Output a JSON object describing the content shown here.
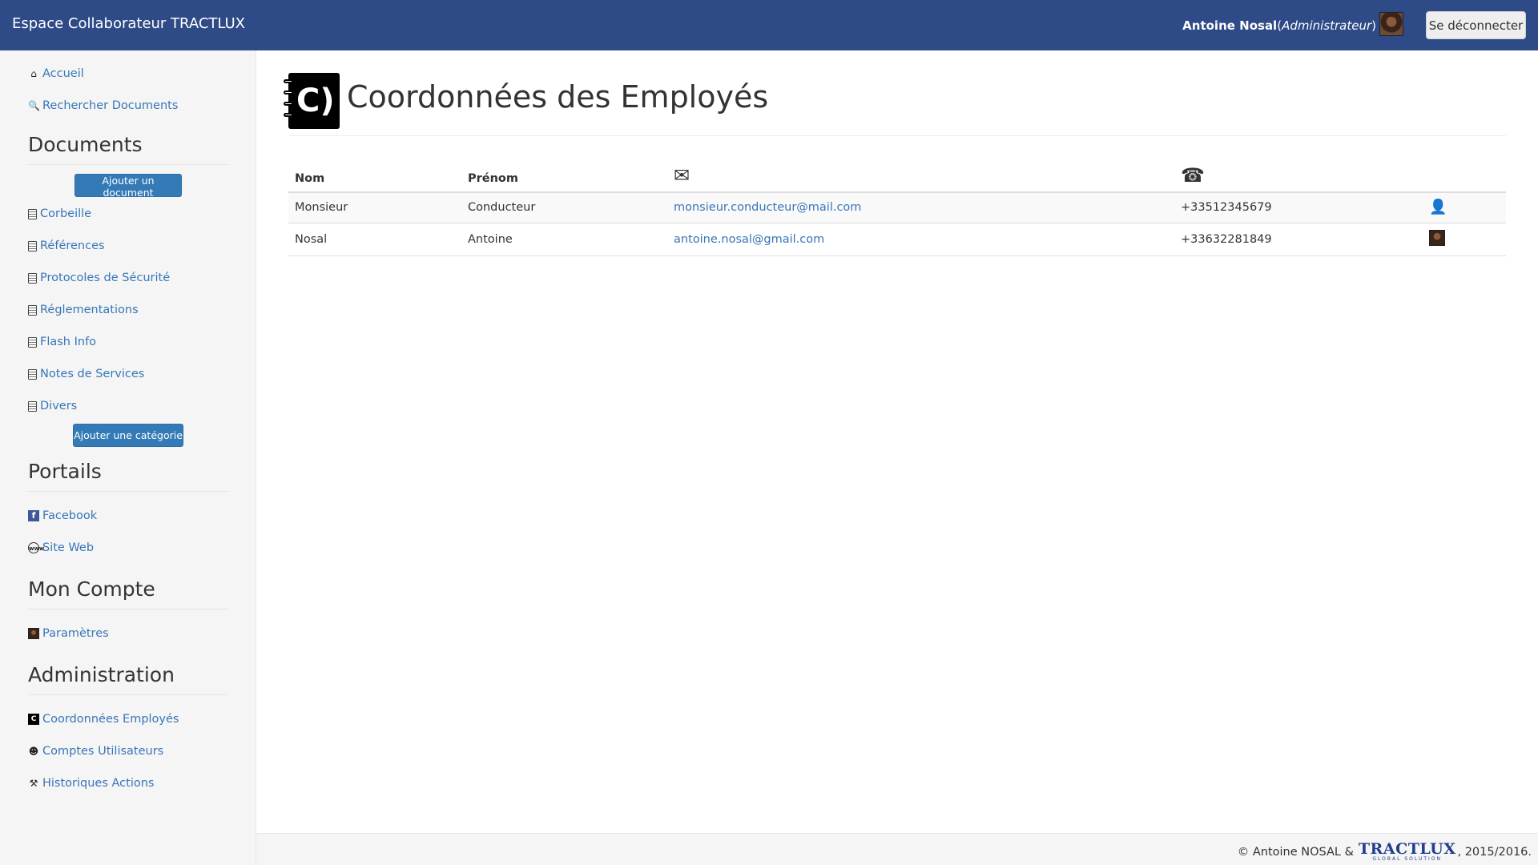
{
  "navbar": {
    "brand": "Espace Collaborateur TRACTLUX",
    "user_name": "Antoine Nosal",
    "user_open": " (",
    "user_role": "Administrateur",
    "user_close": ")",
    "logout_label": "Se déconnecter"
  },
  "sidebar": {
    "home": "Accueil",
    "search_docs": "Rechercher Documents",
    "documents_heading": "Documents",
    "add_document": "Ajouter un document",
    "categories": [
      "Corbeille",
      "Références",
      "Protocoles de Sécurité",
      "Réglementations",
      "Flash Info",
      "Notes de Services",
      "Divers"
    ],
    "add_category": "Ajouter une catégorie",
    "portals_heading": "Portails",
    "facebook": "Facebook",
    "website": "Site Web",
    "account_heading": "Mon Compte",
    "settings": "Paramètres",
    "admin_heading": "Administration",
    "employee_contacts": "Coordonnées Employés",
    "user_accounts": "Comptes Utilisateurs",
    "action_history": "Historiques Actions"
  },
  "main": {
    "title": "Coordonnées des Employés",
    "table": {
      "headers": {
        "nom": "Nom",
        "prenom": "Prénom",
        "email_icon": "envelope-icon",
        "phone_icon": "phone-icon"
      },
      "rows": [
        {
          "nom": "Monsieur",
          "prenom": "Conducteur",
          "email": "monsieur.conducteur@mail.com",
          "phone": "+33512345679",
          "avatar": "user-silhouette-icon"
        },
        {
          "nom": "Nosal",
          "prenom": "Antoine",
          "email": "antoine.nosal@gmail.com",
          "phone": "+33632281849",
          "avatar": "user-photo"
        }
      ]
    }
  },
  "footer": {
    "prefix": "© Antoine NOSAL &",
    "logo_text": "TRACTLUX",
    "logo_sub": "GLOBAL SOLUTION",
    "suffix": ", 2015/2016."
  },
  "colors": {
    "navbar": "#2e4a87",
    "link": "#3776b8",
    "button": "#337ab7",
    "sidebar_bg": "#f5f5f5"
  }
}
